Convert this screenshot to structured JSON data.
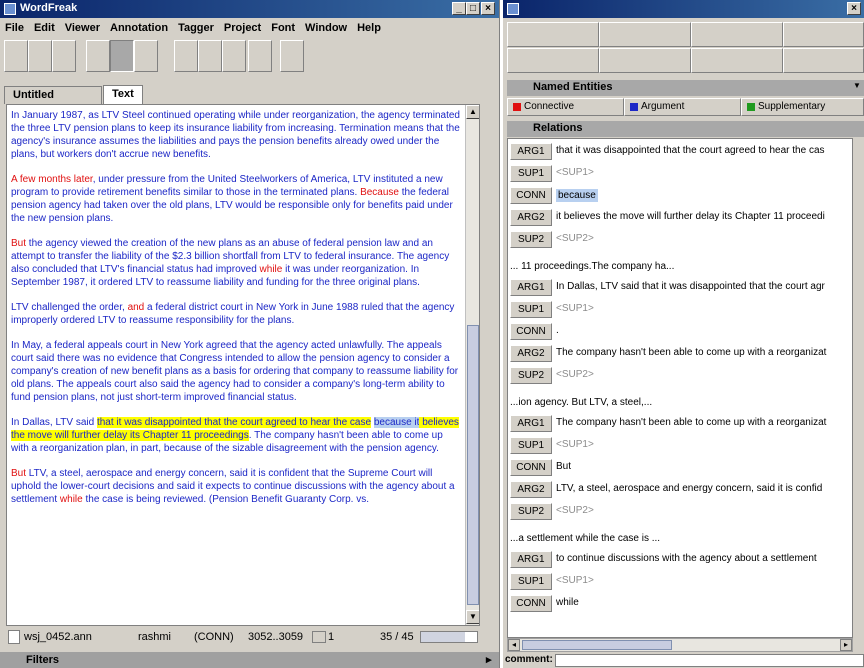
{
  "left_window": {
    "title": "WordFreak",
    "menu": [
      "File",
      "Edit",
      "Viewer",
      "Annotation",
      "Tagger",
      "Project",
      "Font",
      "Window",
      "Help"
    ],
    "tabs": [
      "Untitled Project",
      "Text"
    ],
    "paragraphs": [
      [
        {
          "t": "In January 1987, as LTV Steel continued operating while under reorganization, the agency terminated the three LTV pension plans to keep its insurance liability from increasing. Termination means that the agency's insurance assumes the liabilities and pays the pension benefits already owed under the plans, but workers don't accrue new benefits."
        }
      ],
      [
        {
          "t": "A few months later",
          "c": "red"
        },
        {
          "t": ", under pressure from the United Steelworkers of America, LTV instituted a new program to provide retirement benefits similar to those in the terminated plans. "
        },
        {
          "t": "Because",
          "c": "red"
        },
        {
          "t": " the federal pension agency had taken over the old plans, LTV would be responsible only for benefits paid under the new pension plans."
        }
      ],
      [
        {
          "t": "But",
          "c": "red"
        },
        {
          "t": " the agency viewed the creation of the new plans as an abuse of federal pension law and an attempt to transfer the liability of the $2.3 billion shortfall from LTV to federal insurance. The agency also concluded that LTV's financial status had improved "
        },
        {
          "t": "while",
          "c": "red"
        },
        {
          "t": " it was under reorganization. In September 1987, it ordered LTV to reassume liability and funding for the three original plans."
        }
      ],
      [
        {
          "t": "LTV challenged the order, "
        },
        {
          "t": "and",
          "c": "red"
        },
        {
          "t": " a federal district court in New York in June 1988 ruled that the agency improperly ordered LTV to reassume responsibility for the plans."
        }
      ],
      [
        {
          "t": "In May, a federal appeals court in New York agreed that the agency acted unlawfully. The appeals court said there was no evidence that Congress intended to allow the pension agency to consider a company's creation of new benefit plans as a basis for ordering that company to reassume liability for old plans. The appeals court also said the agency had to consider a company's long-term ability to fund pension plans, not just short-term improved financial status."
        }
      ],
      [
        {
          "t": "In Dallas, LTV said "
        },
        {
          "t": "that it was disappointed that the court agreed to hear the case",
          "c": "hl"
        },
        {
          "t": " "
        },
        {
          "t": "because it",
          "c": "hlb"
        },
        {
          "t": " believes the move will further delay its Chapter 11 proceedings",
          "c": "hl"
        },
        {
          "t": ". The company hasn't been able to come up with a reorganization plan, in part, because of the sizable disagreement with the pension agency."
        }
      ],
      [
        {
          "t": "But",
          "c": "red"
        },
        {
          "t": " LTV, a steel, aerospace and energy concern, said it is confident that the Supreme Court will uphold the lower-court decisions and said it expects to continue discussions with the agency about a settlement "
        },
        {
          "t": "while",
          "c": "red"
        },
        {
          "t": " the case is being reviewed. (Pension Benefit Guaranty Corp. vs."
        }
      ]
    ],
    "status": {
      "file": "wsj_0452.ann",
      "user": "rashmi",
      "tag": "(CONN)",
      "span": "3052..3059",
      "index": "1",
      "progress": "35 / 45"
    },
    "filters_label": "Filters"
  },
  "right_window": {
    "named_entities_label": "Named Entities",
    "entities": [
      {
        "label": "Connective",
        "color": "#e01010"
      },
      {
        "label": "Argument",
        "color": "#1c27c6"
      },
      {
        "label": "Supplementary",
        "color": "#1f9a1f"
      }
    ],
    "relations_label": "Relations",
    "groups": [
      {
        "header": "",
        "rows": [
          {
            "tag": "ARG1",
            "text": "that it was disappointed that the court agreed to hear the cas",
            "sup": false
          },
          {
            "tag": "SUP1",
            "text": "<SUP1>",
            "sup": true
          },
          {
            "tag": "CONN",
            "text": "because",
            "sup": false,
            "hl": true
          },
          {
            "tag": "ARG2",
            "text": "it believes the move will further delay its Chapter 11 proceedi",
            "sup": false
          },
          {
            "tag": "SUP2",
            "text": "<SUP2>",
            "sup": true
          }
        ]
      },
      {
        "header": "... 11 proceedings.The company ha...",
        "rows": [
          {
            "tag": "ARG1",
            "text": "In Dallas, LTV said that it was disappointed that the court agr",
            "sup": false
          },
          {
            "tag": "SUP1",
            "text": "<SUP1>",
            "sup": true
          },
          {
            "tag": "CONN",
            "text": ".",
            "sup": false
          },
          {
            "tag": "ARG2",
            "text": "The company hasn't been able to come up with a reorganizat",
            "sup": false
          },
          {
            "tag": "SUP2",
            "text": "<SUP2>",
            "sup": true
          }
        ]
      },
      {
        "header": "...ion agency. But LTV, a steel,...",
        "rows": [
          {
            "tag": "ARG1",
            "text": "The company hasn't been able to come up with a reorganizat",
            "sup": false
          },
          {
            "tag": "SUP1",
            "text": "<SUP1>",
            "sup": true
          },
          {
            "tag": "CONN",
            "text": "But",
            "sup": false
          },
          {
            "tag": "ARG2",
            "text": "LTV, a steel, aerospace and energy concern, said it is confid",
            "sup": false
          },
          {
            "tag": "SUP2",
            "text": "<SUP2>",
            "sup": true
          }
        ]
      },
      {
        "header": "...a settlement while the case is ...",
        "rows": [
          {
            "tag": "ARG1",
            "text": "to continue discussions with the agency about a settlement",
            "sup": false
          },
          {
            "tag": "SUP1",
            "text": "<SUP1>",
            "sup": true
          },
          {
            "tag": "CONN",
            "text": "while",
            "sup": false
          }
        ]
      }
    ],
    "comment_label": "comment:"
  }
}
